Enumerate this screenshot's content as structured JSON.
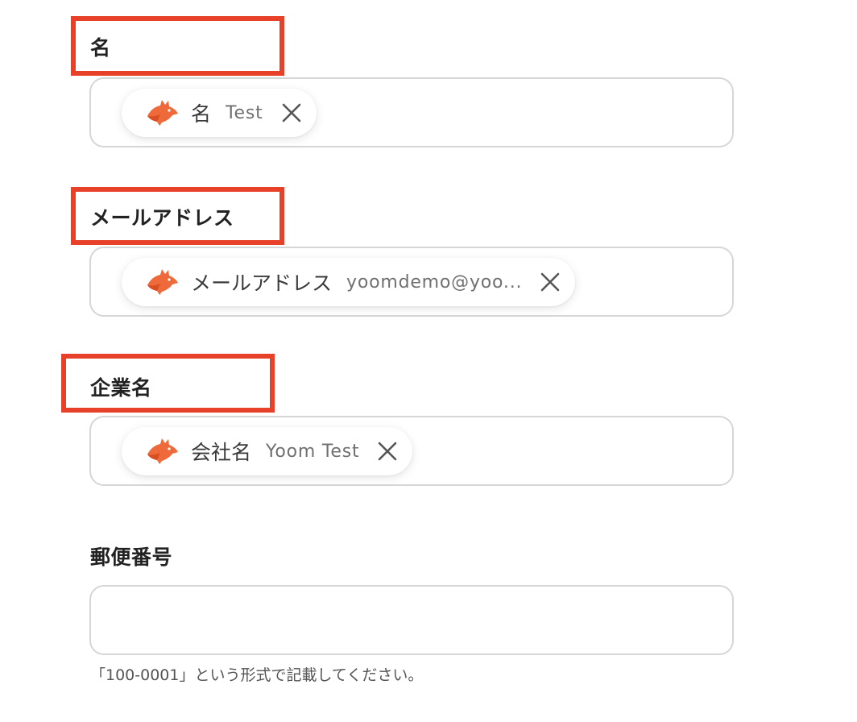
{
  "accent_color": "#e8412a",
  "fields": [
    {
      "label": "名",
      "chip": {
        "icon": "yoom-fox-icon",
        "name": "名",
        "value": "Test",
        "close_icon": "close-icon"
      }
    },
    {
      "label": "メールアドレス",
      "chip": {
        "icon": "yoom-fox-icon",
        "name": "メールアドレス",
        "value": "yoomdemo@yoo...",
        "close_icon": "close-icon"
      }
    },
    {
      "label": "企業名",
      "chip": {
        "icon": "yoom-fox-icon",
        "name": "会社名",
        "value": "Yoom Test",
        "close_icon": "close-icon"
      }
    },
    {
      "label": "郵便番号",
      "value": "",
      "help_text": "「100-0001」という形式で記載してください。"
    }
  ]
}
